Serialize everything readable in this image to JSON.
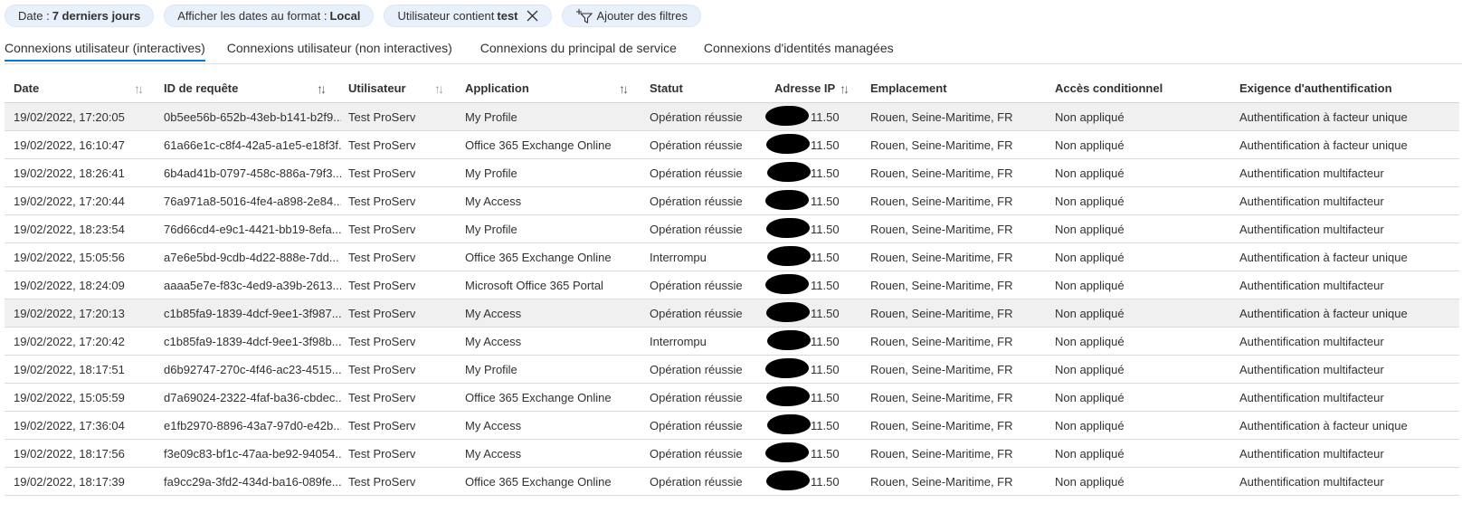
{
  "filters": {
    "date": {
      "label": "Date :",
      "value": "7 derniers jours"
    },
    "format": {
      "label": "Afficher les dates au format :",
      "value": "Local"
    },
    "user": {
      "label": "Utilisateur contient",
      "value": "test"
    },
    "add_filters": "Ajouter des filtres"
  },
  "tabs": [
    {
      "label": "Connexions utilisateur (interactives)",
      "active": true
    },
    {
      "label": "Connexions utilisateur (non interactives)",
      "active": false
    },
    {
      "label": "Connexions du principal de service",
      "active": false
    },
    {
      "label": "Connexions d'identités managées",
      "active": false
    }
  ],
  "columns": {
    "date": "Date",
    "request_id": "ID de requête",
    "user": "Utilisateur",
    "application": "Application",
    "status": "Statut",
    "ip": "Adresse IP",
    "location": "Emplacement",
    "conditional_access": "Accès conditionnel",
    "auth_requirement": "Exigence d'authentification"
  },
  "rows": [
    {
      "date": "19/02/2022, 17:20:05",
      "request_id": "0b5ee56b-652b-43eb-b141-b2f9...",
      "user": "Test ProServ",
      "application": "My Profile",
      "status": "Opération réussie",
      "ip": "11.50",
      "location": "Rouen, Seine-Maritime, FR",
      "ca": "Non appliqué",
      "auth": "Authentification à facteur unique",
      "highlighted": true
    },
    {
      "date": "19/02/2022, 16:10:47",
      "request_id": "61a66e1c-c8f4-42a5-a1e5-e18f3f...",
      "user": "Test ProServ",
      "application": "Office 365 Exchange Online",
      "status": "Opération réussie",
      "ip": "11.50",
      "location": "Rouen, Seine-Maritime, FR",
      "ca": "Non appliqué",
      "auth": "Authentification à facteur unique",
      "highlighted": false
    },
    {
      "date": "19/02/2022, 18:26:41",
      "request_id": "6b4ad41b-0797-458c-886a-79f3...",
      "user": "Test ProServ",
      "application": "My Profile",
      "status": "Opération réussie",
      "ip": "11.50",
      "location": "Rouen, Seine-Maritime, FR",
      "ca": "Non appliqué",
      "auth": "Authentification multifacteur",
      "highlighted": false
    },
    {
      "date": "19/02/2022, 17:20:44",
      "request_id": "76a971a8-5016-4fe4-a898-2e84...",
      "user": "Test ProServ",
      "application": "My Access",
      "status": "Opération réussie",
      "ip": "11.50",
      "location": "Rouen, Seine-Maritime, FR",
      "ca": "Non appliqué",
      "auth": "Authentification multifacteur",
      "highlighted": false
    },
    {
      "date": "19/02/2022, 18:23:54",
      "request_id": "76d66cd4-e9c1-4421-bb19-8efa...",
      "user": "Test ProServ",
      "application": "My Profile",
      "status": "Opération réussie",
      "ip": "11.50",
      "location": "Rouen, Seine-Maritime, FR",
      "ca": "Non appliqué",
      "auth": "Authentification multifacteur",
      "highlighted": false
    },
    {
      "date": "19/02/2022, 15:05:56",
      "request_id": "a7e6e5bd-9cdb-4d22-888e-7dd...",
      "user": "Test ProServ",
      "application": "Office 365 Exchange Online",
      "status": "Interrompu",
      "ip": "11.50",
      "location": "Rouen, Seine-Maritime, FR",
      "ca": "Non appliqué",
      "auth": "Authentification à facteur unique",
      "highlighted": false
    },
    {
      "date": "19/02/2022, 18:24:09",
      "request_id": "aaaa5e7e-f83c-4ed9-a39b-2613...",
      "user": "Test ProServ",
      "application": "Microsoft Office 365 Portal",
      "status": "Opération réussie",
      "ip": "11.50",
      "location": "Rouen, Seine-Maritime, FR",
      "ca": "Non appliqué",
      "auth": "Authentification multifacteur",
      "highlighted": false
    },
    {
      "date": "19/02/2022, 17:20:13",
      "request_id": "c1b85fa9-1839-4dcf-9ee1-3f987...",
      "user": "Test ProServ",
      "application": "My Access",
      "status": "Opération réussie",
      "ip": "11.50",
      "location": "Rouen, Seine-Maritime, FR",
      "ca": "Non appliqué",
      "auth": "Authentification à facteur unique",
      "highlighted": true
    },
    {
      "date": "19/02/2022, 17:20:42",
      "request_id": "c1b85fa9-1839-4dcf-9ee1-3f98b...",
      "user": "Test ProServ",
      "application": "My Access",
      "status": "Interrompu",
      "ip": "11.50",
      "location": "Rouen, Seine-Maritime, FR",
      "ca": "Non appliqué",
      "auth": "Authentification multifacteur",
      "highlighted": false
    },
    {
      "date": "19/02/2022, 18:17:51",
      "request_id": "d6b92747-270c-4f46-ac23-4515...",
      "user": "Test ProServ",
      "application": "My Profile",
      "status": "Opération réussie",
      "ip": "11.50",
      "location": "Rouen, Seine-Maritime, FR",
      "ca": "Non appliqué",
      "auth": "Authentification multifacteur",
      "highlighted": false
    },
    {
      "date": "19/02/2022, 15:05:59",
      "request_id": "d7a69024-2322-4faf-ba36-cbdec...",
      "user": "Test ProServ",
      "application": "Office 365 Exchange Online",
      "status": "Opération réussie",
      "ip": "11.50",
      "location": "Rouen, Seine-Maritime, FR",
      "ca": "Non appliqué",
      "auth": "Authentification multifacteur",
      "highlighted": false
    },
    {
      "date": "19/02/2022, 17:36:04",
      "request_id": "e1fb2970-8896-43a7-97d0-e42b...",
      "user": "Test ProServ",
      "application": "My Access",
      "status": "Opération réussie",
      "ip": "11.50",
      "location": "Rouen, Seine-Maritime, FR",
      "ca": "Non appliqué",
      "auth": "Authentification à facteur unique",
      "highlighted": false
    },
    {
      "date": "19/02/2022, 18:17:56",
      "request_id": "f3e09c83-bf1c-47aa-be92-94054...",
      "user": "Test ProServ",
      "application": "My Access",
      "status": "Opération réussie",
      "ip": "11.50",
      "location": "Rouen, Seine-Maritime, FR",
      "ca": "Non appliqué",
      "auth": "Authentification multifacteur",
      "highlighted": false
    },
    {
      "date": "19/02/2022, 18:17:39",
      "request_id": "fa9cc29a-3fd2-434d-ba16-089fe...",
      "user": "Test ProServ",
      "application": "Office 365 Exchange Online",
      "status": "Opération réussie",
      "ip": "11.50",
      "location": "Rouen, Seine-Maritime, FR",
      "ca": "Non appliqué",
      "auth": "Authentification multifacteur",
      "highlighted": false
    }
  ],
  "colors": {
    "accent": "#0078d4",
    "pill_bg": "#e7f0fb",
    "row_highlight": "#f0f0f0"
  },
  "icons": {
    "remove_filter": "close-icon",
    "add_filter": "filter-add-icon",
    "sort": "sort-arrows-icon"
  }
}
